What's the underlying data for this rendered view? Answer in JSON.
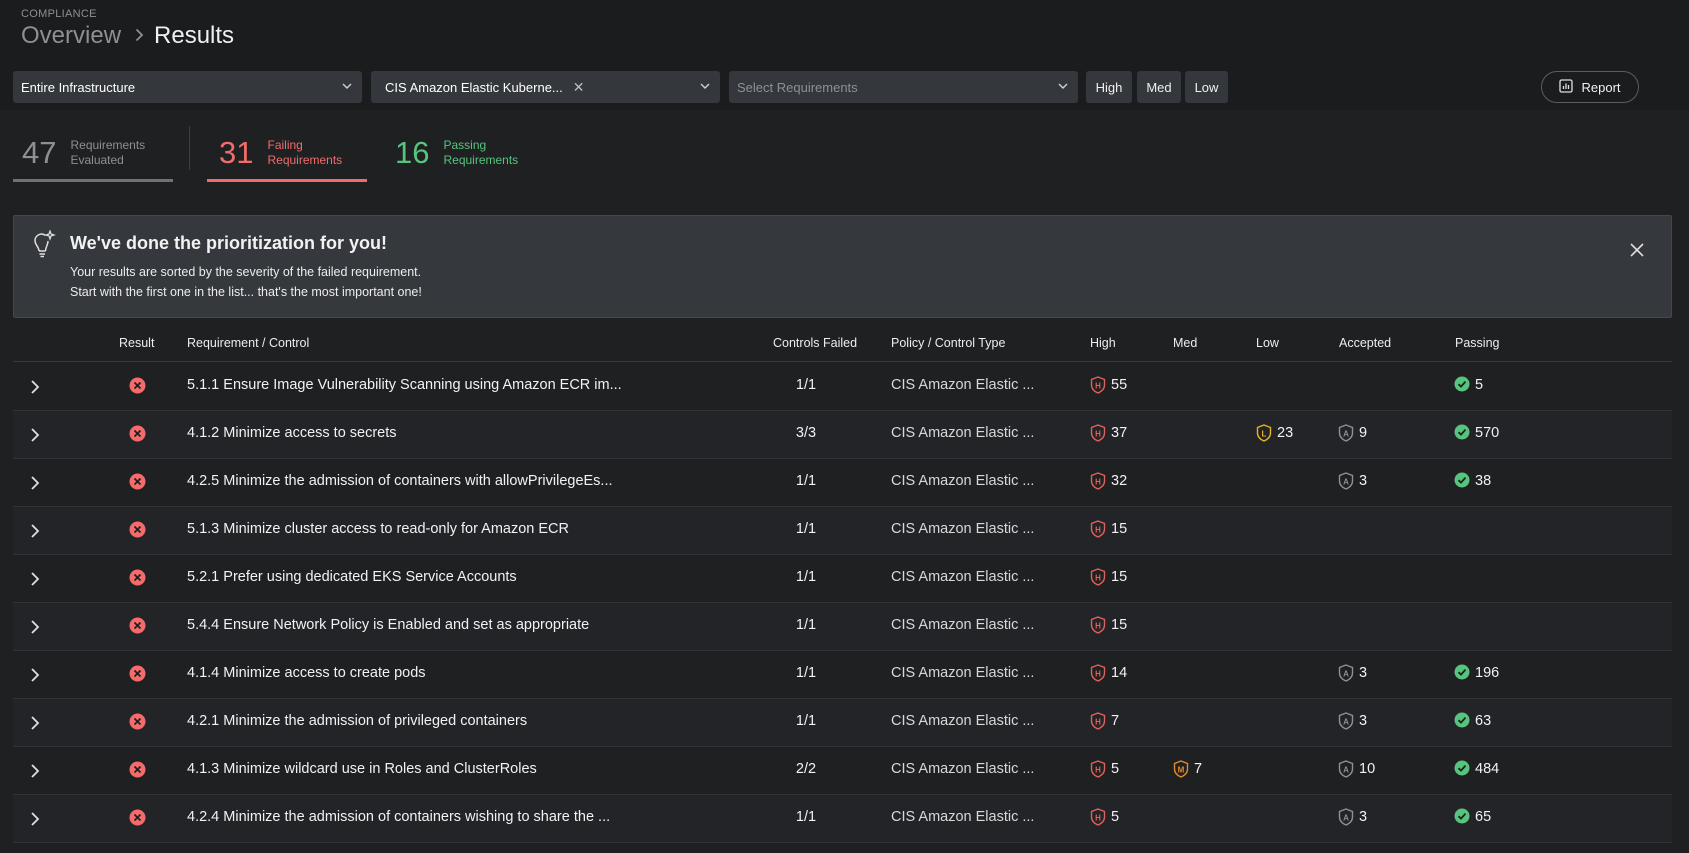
{
  "header": {
    "section": "COMPLIANCE",
    "breadcrumb": {
      "parent": "Overview",
      "current": "Results"
    }
  },
  "filters": {
    "infrastructure": "Entire Infrastructure",
    "policy": "CIS Amazon Elastic Kuberne...",
    "requirements_placeholder": "Select Requirements",
    "severity_buttons": [
      "High",
      "Med",
      "Low"
    ],
    "report_label": "Report"
  },
  "stats": {
    "evaluated": {
      "value": "47",
      "label_1": "Requirements",
      "label_2": "Evaluated"
    },
    "failing": {
      "value": "31",
      "label_1": "Failing",
      "label_2": "Requirements"
    },
    "passing": {
      "value": "16",
      "label_1": "Passing",
      "label_2": "Requirements"
    }
  },
  "banner": {
    "title": "We've done the prioritization for you!",
    "line1": "Your results are sorted by the severity of the failed requirement.",
    "line2": "Start with the first one in the list... that's the most important one!"
  },
  "table": {
    "columns": {
      "result": "Result",
      "requirement": "Requirement / Control",
      "controls_failed": "Controls Failed",
      "policy": "Policy / Control Type",
      "high": "High",
      "med": "Med",
      "low": "Low",
      "accepted": "Accepted",
      "passing": "Passing"
    },
    "rows": [
      {
        "requirement": "5.1.1 Ensure Image Vulnerability Scanning using Amazon ECR im...",
        "controls_failed": "1/1",
        "policy": "CIS Amazon Elastic ...",
        "high": "55",
        "med": "",
        "low": "",
        "accepted": "",
        "passing": "5"
      },
      {
        "requirement": "4.1.2 Minimize access to secrets",
        "controls_failed": "3/3",
        "policy": "CIS Amazon Elastic ...",
        "high": "37",
        "med": "",
        "low": "23",
        "accepted": "9",
        "passing": "570"
      },
      {
        "requirement": "4.2.5 Minimize the admission of containers with allowPrivilegeEs...",
        "controls_failed": "1/1",
        "policy": "CIS Amazon Elastic ...",
        "high": "32",
        "med": "",
        "low": "",
        "accepted": "3",
        "passing": "38"
      },
      {
        "requirement": "5.1.3 Minimize cluster access to read-only for Amazon ECR",
        "controls_failed": "1/1",
        "policy": "CIS Amazon Elastic ...",
        "high": "15",
        "med": "",
        "low": "",
        "accepted": "",
        "passing": ""
      },
      {
        "requirement": "5.2.1 Prefer using dedicated EKS Service Accounts",
        "controls_failed": "1/1",
        "policy": "CIS Amazon Elastic ...",
        "high": "15",
        "med": "",
        "low": "",
        "accepted": "",
        "passing": ""
      },
      {
        "requirement": "5.4.4 Ensure Network Policy is Enabled and set as appropriate",
        "controls_failed": "1/1",
        "policy": "CIS Amazon Elastic ...",
        "high": "15",
        "med": "",
        "low": "",
        "accepted": "",
        "passing": ""
      },
      {
        "requirement": "4.1.4 Minimize access to create pods",
        "controls_failed": "1/1",
        "policy": "CIS Amazon Elastic ...",
        "high": "14",
        "med": "",
        "low": "",
        "accepted": "3",
        "passing": "196"
      },
      {
        "requirement": "4.2.1 Minimize the admission of privileged containers",
        "controls_failed": "1/1",
        "policy": "CIS Amazon Elastic ...",
        "high": "7",
        "med": "",
        "low": "",
        "accepted": "3",
        "passing": "63"
      },
      {
        "requirement": "4.1.3 Minimize wildcard use in Roles and ClusterRoles",
        "controls_failed": "2/2",
        "policy": "CIS Amazon Elastic ...",
        "high": "5",
        "med": "7",
        "low": "",
        "accepted": "10",
        "passing": "484"
      },
      {
        "requirement": "4.2.4 Minimize the admission of containers wishing to share the ...",
        "controls_failed": "1/1",
        "policy": "CIS Amazon Elastic ...",
        "high": "5",
        "med": "",
        "low": "",
        "accepted": "3",
        "passing": "65"
      }
    ]
  },
  "colors": {
    "failing": "#f26c6c",
    "passing": "#57c47e",
    "high": "#e0605a",
    "med": "#e08a2e",
    "low": "#e8b425",
    "accepted": "#8d9094"
  },
  "icons": {
    "result": "fail-circle-icon",
    "high": "high-severity-shield-icon",
    "med": "medium-severity-shield-icon",
    "low": "low-severity-shield-icon",
    "accepted": "accepted-shield-icon",
    "passing": "check-circle-icon"
  }
}
